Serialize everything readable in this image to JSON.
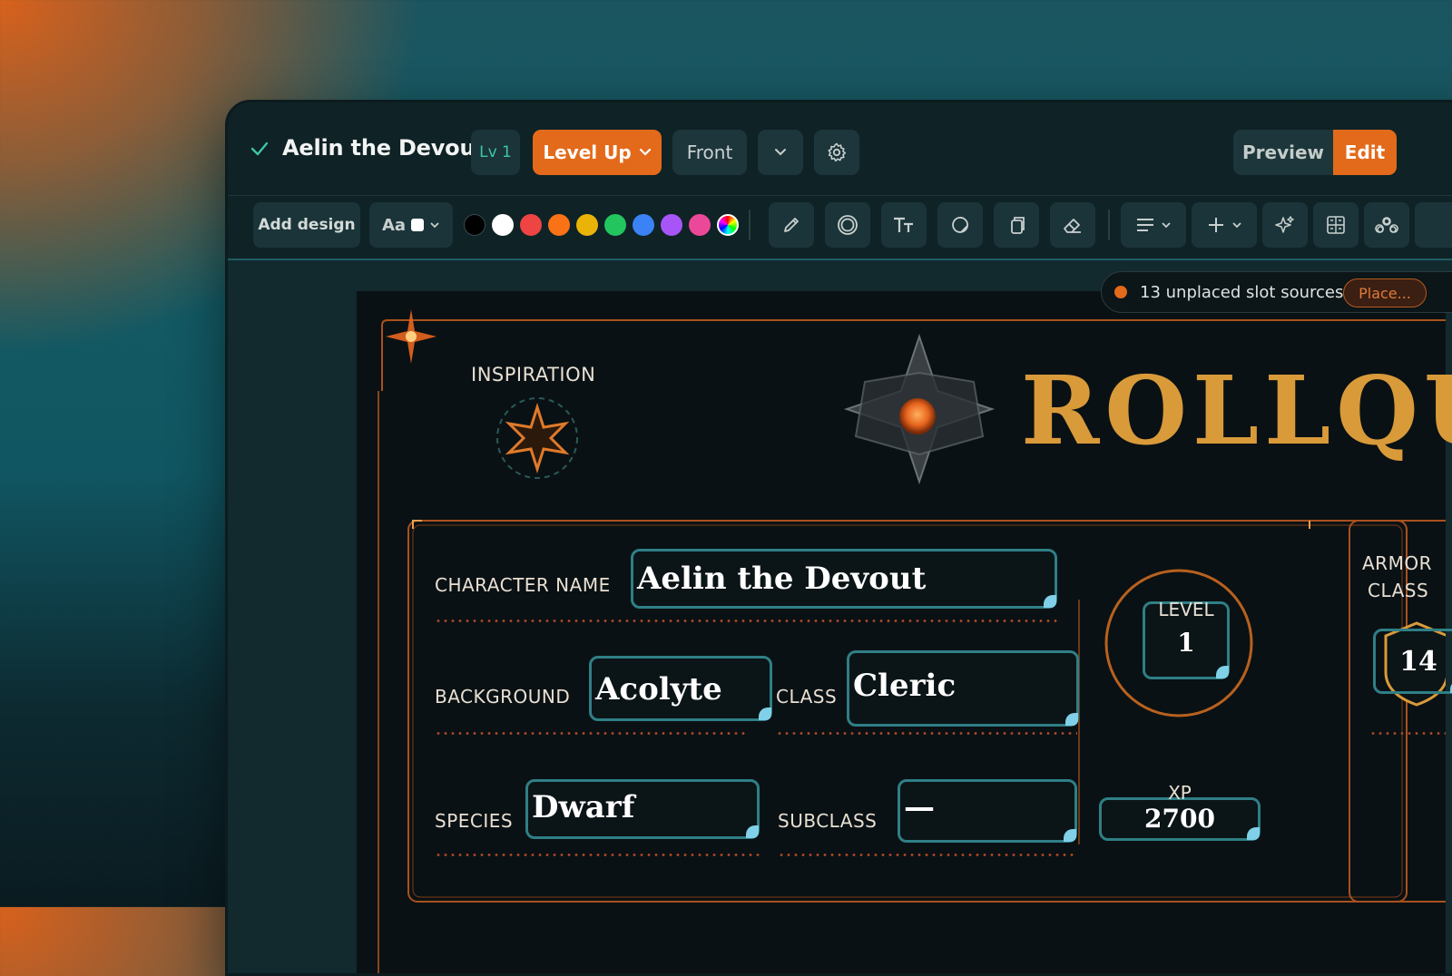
{
  "titlebar": {
    "doc_title": "Aelin the Devout",
    "level_badge": "Lv 1",
    "level_up_label": "Level Up",
    "side_label": "Front",
    "preview_label": "Preview",
    "edit_label": "Edit"
  },
  "toolbar": {
    "add_design_label": "Add design",
    "font_label": "Aa",
    "swatches": [
      "#000000",
      "#ffffff",
      "#ef4444",
      "#f97316",
      "#eab308",
      "#22c55e",
      "#3b82f6",
      "#a855f7",
      "#ec4899",
      "rainbow"
    ]
  },
  "notice": {
    "text": "13 unplaced slot sources",
    "action_label": "Place..."
  },
  "sheet": {
    "inspiration_label": "INSPIRATION",
    "brand_title": "ROLLQU",
    "character_name_label": "CHARACTER NAME",
    "character_name": "Aelin the Devout",
    "background_label": "BACKGROUND",
    "background": "Acolyte",
    "class_label": "CLASS",
    "class": "Cleric",
    "species_label": "SPECIES",
    "species": "Dwarf",
    "subclass_label": "SUBCLASS",
    "subclass": "—",
    "level_label": "LEVEL",
    "level": "1",
    "xp_label": "XP",
    "xp": "2700",
    "armor_class_label_1": "ARMOR",
    "armor_class_label_2": "CLASS",
    "armor_class": "14"
  },
  "colors": {
    "accent": "#e36a1a",
    "panel": "#0f2226",
    "field_border": "#2f7f86",
    "gold": "#d99a3a"
  }
}
